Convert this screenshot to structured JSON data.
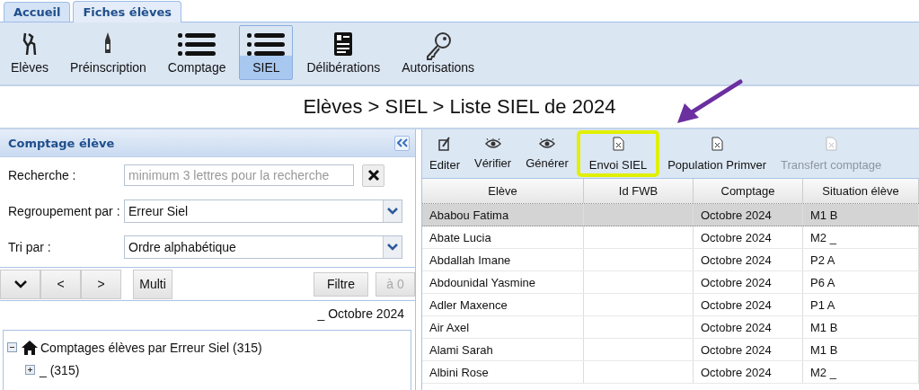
{
  "tabs": [
    {
      "label": "Accueil",
      "selected": false
    },
    {
      "label": "Fiches élèves",
      "selected": true
    }
  ],
  "ribbon": [
    {
      "label": "Elèves",
      "selected": false
    },
    {
      "label": "Préinscription",
      "selected": false
    },
    {
      "label": "Comptage",
      "selected": false
    },
    {
      "label": "SIEL",
      "selected": true
    },
    {
      "label": "Délibérations",
      "selected": false
    },
    {
      "label": "Autorisations",
      "selected": false
    }
  ],
  "breadcrumb": "Elèves > SIEL > Liste SIEL de 2024",
  "left_panel": {
    "title": "Comptage élève",
    "search": {
      "label": "Recherche :",
      "placeholder": "minimum 3 lettres pour la recherche"
    },
    "group_by": {
      "label": "Regroupement par :",
      "value": "Erreur Siel"
    },
    "sort_by": {
      "label": "Tri par :",
      "value": "Ordre alphabétique"
    },
    "buttons": [
      {
        "label": "<"
      },
      {
        "label": ">"
      }
    ],
    "multi": "Multi",
    "filter": "Filtre",
    "reset": {
      "label": "à 0",
      "disabled": true
    },
    "period": "_ Octobre 2024",
    "tree": [
      {
        "label": "Comptages élèves par Erreur Siel (315)",
        "expanded": true,
        "children": [
          {
            "label": "_ (315)",
            "expanded": false
          }
        ]
      }
    ]
  },
  "toolbar": [
    {
      "label": "Editer",
      "disabled": false,
      "highlighted": false
    },
    {
      "label": "Vérifier",
      "disabled": false,
      "highlighted": false
    },
    {
      "label": "Générer",
      "disabled": false,
      "highlighted": false
    },
    {
      "label": "Envoi SIEL",
      "disabled": false,
      "highlighted": true
    },
    {
      "label": "Population Primver",
      "disabled": false,
      "highlighted": false
    },
    {
      "label": "Transfert comptage",
      "disabled": true,
      "highlighted": false
    }
  ],
  "table": {
    "columns": [
      "Elève",
      "Id FWB",
      "Comptage",
      "Situation élève"
    ],
    "rows": [
      {
        "cells": [
          "Ababou Fatima",
          "",
          "Octobre 2024",
          "M1 B"
        ],
        "selected": true
      },
      {
        "cells": [
          "Abate Lucia",
          "",
          "Octobre 2024",
          "M2 _"
        ],
        "selected": false
      },
      {
        "cells": [
          "Abdallah Imane",
          "",
          "Octobre 2024",
          "P2 A"
        ],
        "selected": false
      },
      {
        "cells": [
          "Abdounidal Yasmine",
          "",
          "Octobre 2024",
          "P6 A"
        ],
        "selected": false
      },
      {
        "cells": [
          "Adler Maxence",
          "",
          "Octobre 2024",
          "P1 A"
        ],
        "selected": false
      },
      {
        "cells": [
          "Air Axel",
          "",
          "Octobre 2024",
          "M1 B"
        ],
        "selected": false
      },
      {
        "cells": [
          "Alami Sarah",
          "",
          "Octobre 2024",
          "M1 B"
        ],
        "selected": false
      },
      {
        "cells": [
          "Albini Rose",
          "",
          "Octobre 2024",
          "M2 _"
        ],
        "selected": false
      }
    ]
  }
}
